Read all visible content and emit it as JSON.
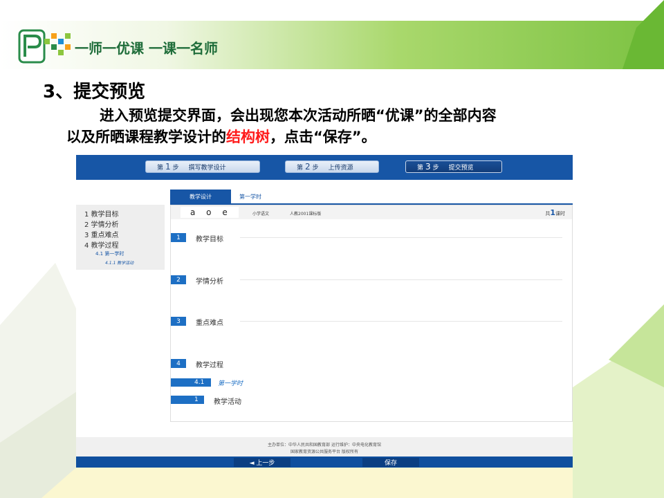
{
  "logo": {
    "text": "一师一优课 一课一名师"
  },
  "slide": {
    "title": "3、提交预览",
    "line1": "进入预览提交界面，会出现您本次活动所晒“优课”的全部内容",
    "line2_before": "以及所晒课程教学设计的",
    "line2_highlight": "结构树",
    "line2_after": "，点击“保存”。",
    "highlight_color": "#ff1a1a"
  },
  "steps": [
    {
      "prefix": "第",
      "num": "1",
      "suffix": "步",
      "label": "撰写教学设计"
    },
    {
      "prefix": "第",
      "num": "2",
      "suffix": "步",
      "label": "上传资源"
    },
    {
      "prefix": "第",
      "num": "3",
      "suffix": "步",
      "label": "提交预览"
    }
  ],
  "tabs": {
    "active": "教学设计",
    "other": "第一学时"
  },
  "sidebar": {
    "items": [
      "1 教学目标",
      "2 学情分析",
      "3 重点难点",
      "4 教学过程"
    ],
    "sub": "4.1 第一学时",
    "subsub": "4.1.1 教学活动"
  },
  "lesson": {
    "name": "a o e",
    "subject": "小学语文",
    "edition": "人教2001课标版",
    "total_prefix": "共",
    "total_num": "1",
    "total_suffix": "课时"
  },
  "sections": [
    {
      "num": "1",
      "label": "教学目标"
    },
    {
      "num": "2",
      "label": "学情分析"
    },
    {
      "num": "3",
      "label": "重点难点"
    },
    {
      "num": "4",
      "label": "教学过程"
    }
  ],
  "subsection": {
    "num": "4.1",
    "label": "第一学时"
  },
  "activity": {
    "num": "1",
    "label": "教学活动"
  },
  "footer": {
    "line1": "主办单位：中华人民共和国教育部 运行维护：中央电化教育馆",
    "line2": "国家教育资源公共服务平台 版权所有"
  },
  "buttons": {
    "prev": "◄ 上一步",
    "save": "保存"
  },
  "colors": {
    "primary_blue": "#1756a6",
    "badge_blue": "#1d6fc4",
    "green": "#7cc242"
  }
}
